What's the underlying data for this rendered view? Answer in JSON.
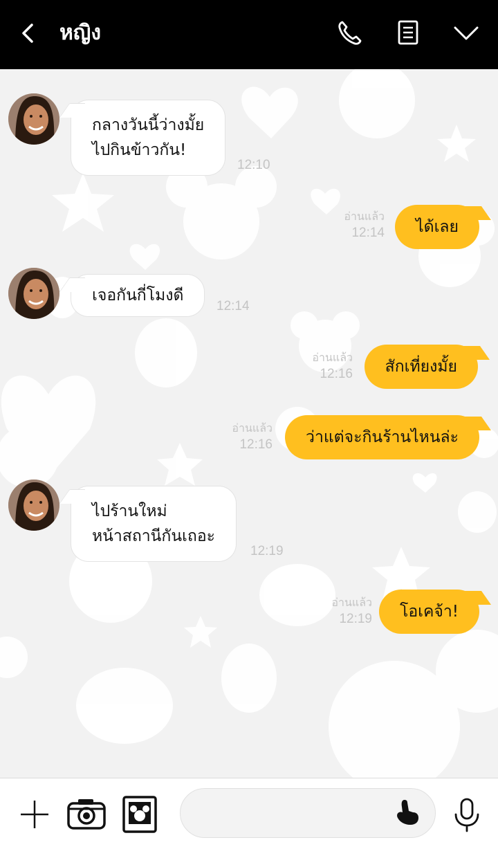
{
  "header": {
    "title": "หญิง",
    "back_icon": "chevron-left-icon",
    "call_icon": "phone-icon",
    "notes_icon": "notes-icon",
    "menu_icon": "chevron-down-icon"
  },
  "messages": [
    {
      "side": "in",
      "lines": [
        "กลางวันนี้ว่างมั้ย",
        "ไปกินข้าวกัน!"
      ],
      "time": "12:10"
    },
    {
      "side": "out",
      "text": "ได้เลย",
      "read": "อ่านแล้ว",
      "time": "12:14"
    },
    {
      "side": "in",
      "lines": [
        "เจอกันกี่โมงดี"
      ],
      "time": "12:14"
    },
    {
      "side": "out",
      "text": "สักเที่ยงมั้ย",
      "read": "อ่านแล้ว",
      "time": "12:16"
    },
    {
      "side": "out",
      "text": "ว่าแต่จะกินร้านไหนล่ะ",
      "read": "อ่านแล้ว",
      "time": "12:16"
    },
    {
      "side": "in",
      "lines": [
        "ไปร้านใหม่",
        "หน้าสถานีกันเถอะ"
      ],
      "time": "12:19"
    },
    {
      "side": "out",
      "text": "โอเคจ้า!",
      "read": "อ่านแล้ว",
      "time": "12:19"
    }
  ],
  "composer": {
    "placeholder": "",
    "add_icon": "plus-icon",
    "camera_icon": "camera-icon",
    "photo_icon": "photo-icon",
    "sticker_icon": "glove-sticker-icon",
    "mic_icon": "microphone-icon"
  },
  "colors": {
    "header_bg": "#000000",
    "bubble_out": "#ffbf1f",
    "bubble_in": "#ffffff",
    "chat_bg": "#f2f2f2"
  }
}
